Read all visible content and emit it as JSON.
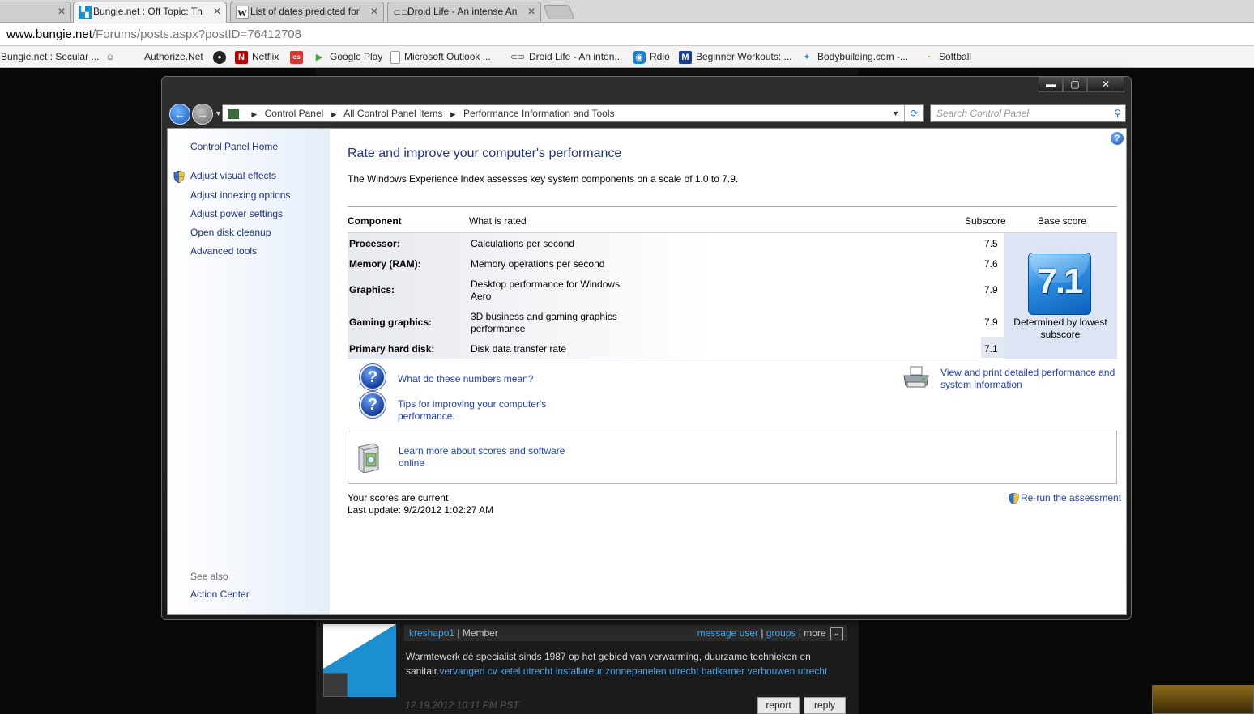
{
  "browser": {
    "tabs": [
      {
        "label": "",
        "icon": "page-icon"
      },
      {
        "label": "Bungie.net : Off Topic: Th",
        "icon": "bungie-icon"
      },
      {
        "label": "List of dates predicted for",
        "icon": "wikipedia-icon"
      },
      {
        "label": "Droid Life - An intense An",
        "icon": "droid-icon"
      }
    ],
    "close_glyph": "✕",
    "address": {
      "host": "www.bungie.net",
      "path": "/Forums/posts.aspx?postID=76412708"
    },
    "bookmarks": [
      {
        "label": "Bungie.net : Secular ...",
        "icon": ""
      },
      {
        "label": "",
        "icon": "reddit-icon"
      },
      {
        "label": "Authorize.Net",
        "icon": ""
      },
      {
        "label": "",
        "icon": "pcu-icon"
      },
      {
        "label": "Netflix",
        "icon": "netflix-icon"
      },
      {
        "label": "",
        "icon": "os-icon"
      },
      {
        "label": "Google Play",
        "icon": "google-play-icon"
      },
      {
        "label": "Microsoft Outlook ...",
        "icon": "page-icon"
      },
      {
        "label": "Droid Life - An inten...",
        "icon": "droid-icon"
      },
      {
        "label": "Rdio",
        "icon": "rdio-icon"
      },
      {
        "label": "Beginner Workouts: ...",
        "icon": "workout-icon"
      },
      {
        "label": "Bodybuilding.com -...",
        "icon": "bodybuilding-icon"
      },
      {
        "label": "Softball",
        "icon": "softball-icon"
      }
    ]
  },
  "window": {
    "buttons": {
      "minimize": "▬",
      "maximize": "▢",
      "close": "✕"
    },
    "breadcrumb": [
      "Control Panel",
      "All Control Panel Items",
      "Performance Information and Tools"
    ],
    "search_placeholder": "Search Control Panel"
  },
  "sidebar": {
    "home": "Control Panel Home",
    "links": [
      "Adjust visual effects",
      "Adjust indexing options",
      "Adjust power settings",
      "Open disk cleanup",
      "Advanced tools"
    ],
    "see_also_heading": "See also",
    "see_also": [
      "Action Center"
    ]
  },
  "main": {
    "title": "Rate and improve your computer's performance",
    "description": "The Windows Experience Index assesses key system components on a scale of 1.0 to 7.9.",
    "headers": {
      "component": "Component",
      "what": "What is rated",
      "subscore": "Subscore",
      "base": "Base score"
    },
    "rows": [
      {
        "component": "Processor:",
        "what": "Calculations per second",
        "subscore": "7.5"
      },
      {
        "component": "Memory (RAM):",
        "what": "Memory operations per second",
        "subscore": "7.6"
      },
      {
        "component": "Graphics:",
        "what": "Desktop performance for Windows Aero",
        "subscore": "7.9"
      },
      {
        "component": "Gaming graphics:",
        "what": "3D business and gaming graphics performance",
        "subscore": "7.9"
      },
      {
        "component": "Primary hard disk:",
        "what": "Disk data transfer rate",
        "subscore": "7.1"
      }
    ],
    "base_score": "7.1",
    "base_caption": "Determined by lowest subscore",
    "links": {
      "numbers": "What do these numbers mean?",
      "tips": "Tips for improving your computer's performance.",
      "print": "View and print detailed performance and system information",
      "learn": "Learn more about scores and software online"
    },
    "status": "Your scores are current",
    "last_update": "Last update: 9/2/2012 1:02:27 AM",
    "rerun": "Re-run the assessment"
  },
  "forum": {
    "username": "kreshapo1",
    "role": "| Member",
    "message_user": "message user",
    "groups": "groups",
    "more": "| more",
    "separator": "|",
    "body_text": "Warmtewerk dé specialist sinds 1987 op het gebied van verwarming, duurzame technieken en sanitair.",
    "body_links": "vervangen cv ketel utrecht installateur zonnepanelen utrecht badkamer verbouwen utrecht",
    "date": "12.19.2012 10:11 PM PST",
    "report": "report",
    "reply": "reply"
  },
  "colors": {
    "link": "#1e3fc8",
    "title": "#1e3287",
    "forum_link": "#3fa9f5",
    "badge": "#2a8be0"
  }
}
